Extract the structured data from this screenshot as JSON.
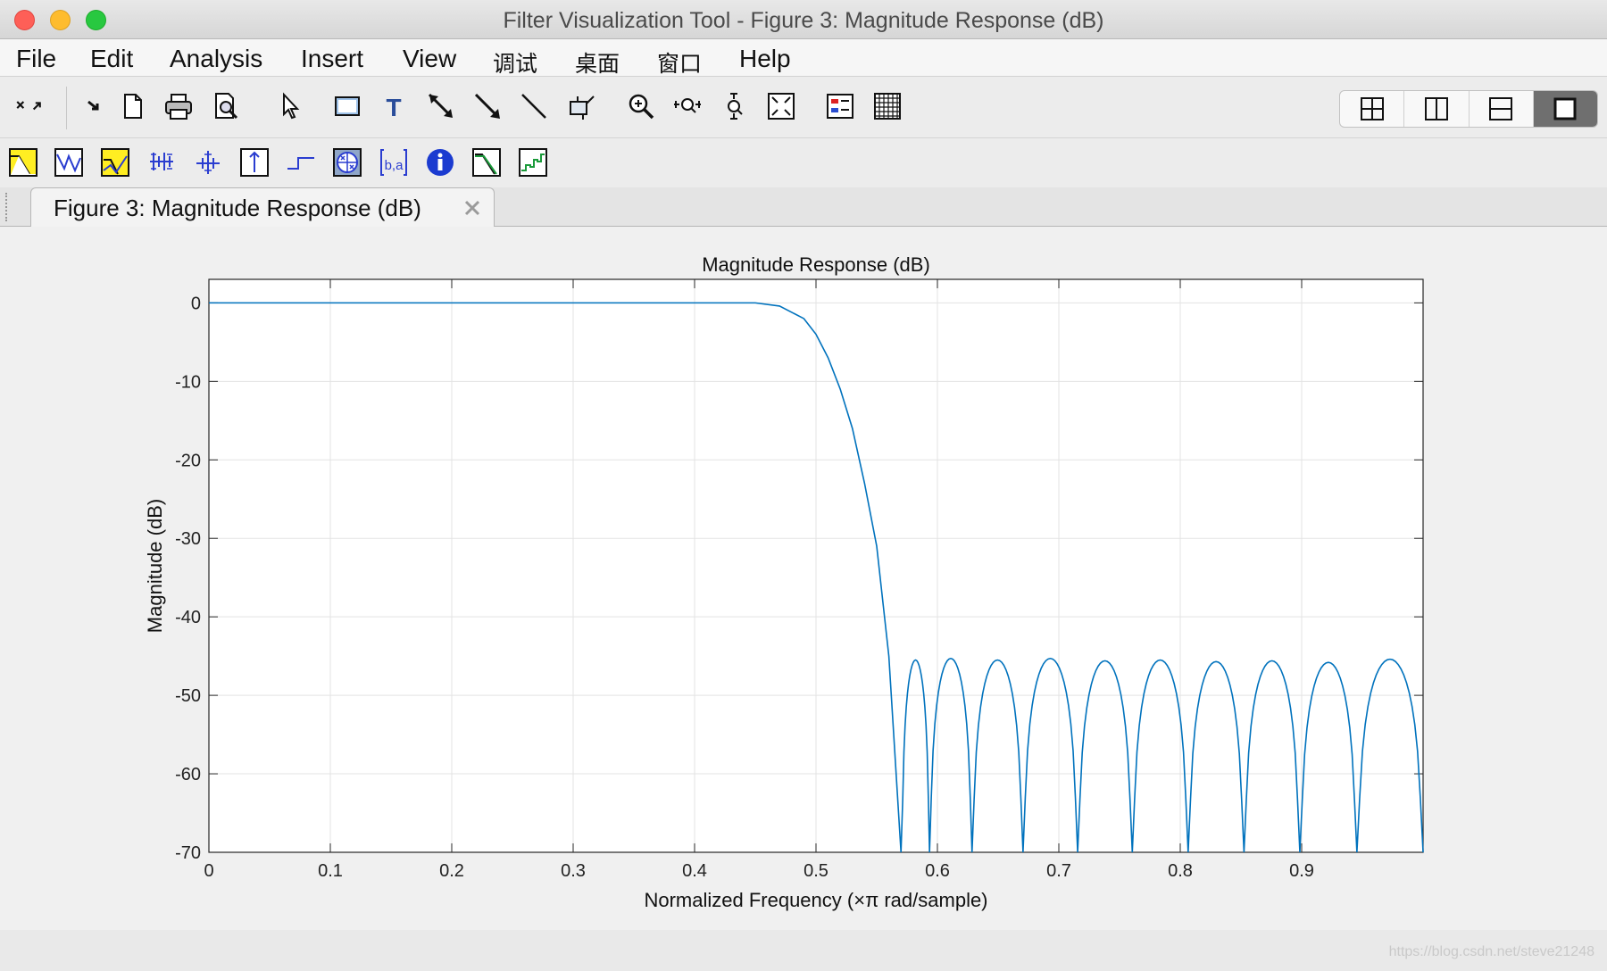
{
  "window": {
    "title": "Filter Visualization Tool - Figure 3: Magnitude Response (dB)"
  },
  "menu": {
    "items": [
      "File",
      "Edit",
      "Analysis",
      "Insert",
      "View",
      "调试",
      "桌面",
      "窗口",
      "Help"
    ]
  },
  "toolbar": {
    "icons": [
      "undock-icon",
      "redo-arrow-icon",
      "new-file-icon",
      "print-icon",
      "print-preview-icon",
      "select-pointer-icon",
      "rectangle-icon",
      "text-insert-icon",
      "arrow-icon",
      "double-arrow-icon",
      "line-icon",
      "pin-icon",
      "zoom-in-icon",
      "zoom-x-icon",
      "zoom-y-icon",
      "full-view-icon",
      "legend-icon",
      "grid-icon"
    ],
    "layout_icons": [
      "tile-grid-icon",
      "tile-columns-icon",
      "tile-rows-icon",
      "single-view-icon"
    ]
  },
  "analysis_toolbar": {
    "icons": [
      "magnitude-response-icon",
      "phase-response-icon",
      "magnitude-phase-icon",
      "group-delay-icon",
      "phase-delay-icon",
      "impulse-response-icon",
      "step-response-icon",
      "pole-zero-icon",
      "coefficients-icon",
      "info-icon",
      "magnitude-estimate-icon",
      "round-off-noise-icon"
    ]
  },
  "tab": {
    "label": "Figure 3: Magnitude Response (dB)"
  },
  "watermark": "https://blog.csdn.net/steve21248",
  "colors": {
    "series": "#0072bd",
    "grid": "#e3e3e3",
    "axes": "#262626",
    "info_icon": "#1b3bd0"
  },
  "chart_data": {
    "type": "line",
    "title": "Magnitude Response (dB)",
    "xlabel": "Normalized Frequency (×π rad/sample)",
    "ylabel": "Magnitude (dB)",
    "xlim": [
      0,
      1
    ],
    "ylim": [
      -70,
      3
    ],
    "grid": true,
    "xticks": [
      0,
      0.1,
      0.2,
      0.3,
      0.4,
      0.5,
      0.6,
      0.7,
      0.8,
      0.9
    ],
    "xtick_labels": [
      "0",
      "0.1",
      "0.2",
      "0.3",
      "0.4",
      "0.5",
      "0.6",
      "0.7",
      "0.8",
      "0.9"
    ],
    "yticks": [
      0,
      -10,
      -20,
      -30,
      -40,
      -50,
      -60,
      -70
    ],
    "ytick_labels": [
      "0",
      "-10",
      "-20",
      "-30",
      "-40",
      "-50",
      "-60",
      "-70"
    ],
    "passband": {
      "x": [
        0,
        0.45
      ],
      "y": 0
    },
    "transition": {
      "x": [
        0.45,
        0.47,
        0.49,
        0.5,
        0.51,
        0.52,
        0.53,
        0.54,
        0.55,
        0.56,
        0.57
      ],
      "y": [
        0,
        -0.4,
        -2,
        -4,
        -7,
        -11,
        -16,
        -23,
        -31,
        -45,
        -70
      ]
    },
    "stopband": {
      "nulls": [
        0.5705,
        0.5935,
        0.6285,
        0.6705,
        0.7155,
        0.7605,
        0.8065,
        0.8525,
        0.8985,
        0.9455,
        1.0
      ],
      "peaks": [
        {
          "x": 0.58,
          "y": -45.5
        },
        {
          "x": 0.613,
          "y": -45.3
        },
        {
          "x": 0.652,
          "y": -45.5
        },
        {
          "x": 0.696,
          "y": -45.3
        },
        {
          "x": 0.741,
          "y": -45.6
        },
        {
          "x": 0.788,
          "y": -45.5
        },
        {
          "x": 0.834,
          "y": -45.7
        },
        {
          "x": 0.881,
          "y": -45.6
        },
        {
          "x": 0.927,
          "y": -45.8
        },
        {
          "x": 0.973,
          "y": -45.4
        }
      ]
    }
  }
}
